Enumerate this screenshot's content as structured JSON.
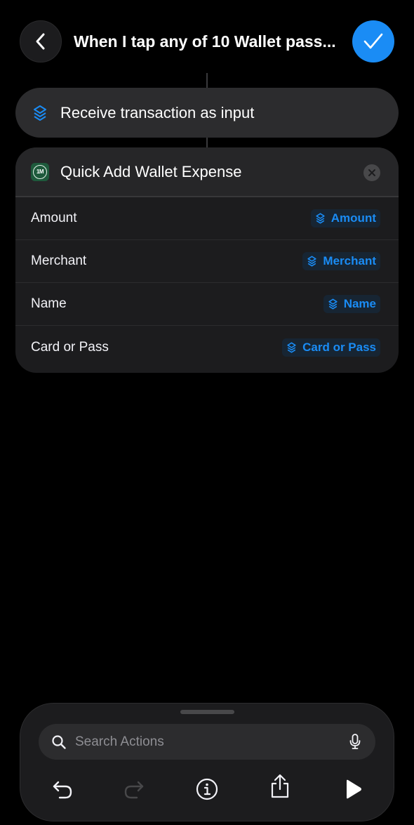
{
  "header": {
    "title": "When I tap any of 10 Wallet pass...",
    "back_icon": "chevron-left-icon",
    "done_icon": "checkmark-icon"
  },
  "trigger": {
    "label": "Receive transaction as input",
    "icon": "wallet-stack-icon"
  },
  "action": {
    "app_icon_text": "1M",
    "title": "Quick Add Wallet Expense",
    "remove_icon": "close-icon",
    "params": [
      {
        "label": "Amount",
        "token": "Amount"
      },
      {
        "label": "Merchant",
        "token": "Merchant"
      },
      {
        "label": "Name",
        "token": "Name"
      },
      {
        "label": "Card or Pass",
        "token": "Card or Pass"
      }
    ]
  },
  "bottom": {
    "search_placeholder": "Search Actions",
    "search_value": "",
    "toolbar": [
      "undo-icon",
      "redo-icon",
      "info-icon",
      "share-icon",
      "play-icon"
    ]
  },
  "colors": {
    "accent": "#1a8cf5",
    "background": "#000000",
    "card": "#1c1c1e",
    "card_header": "#262628",
    "token_bg": "#172533",
    "app_icon": "#1e5a3c"
  }
}
